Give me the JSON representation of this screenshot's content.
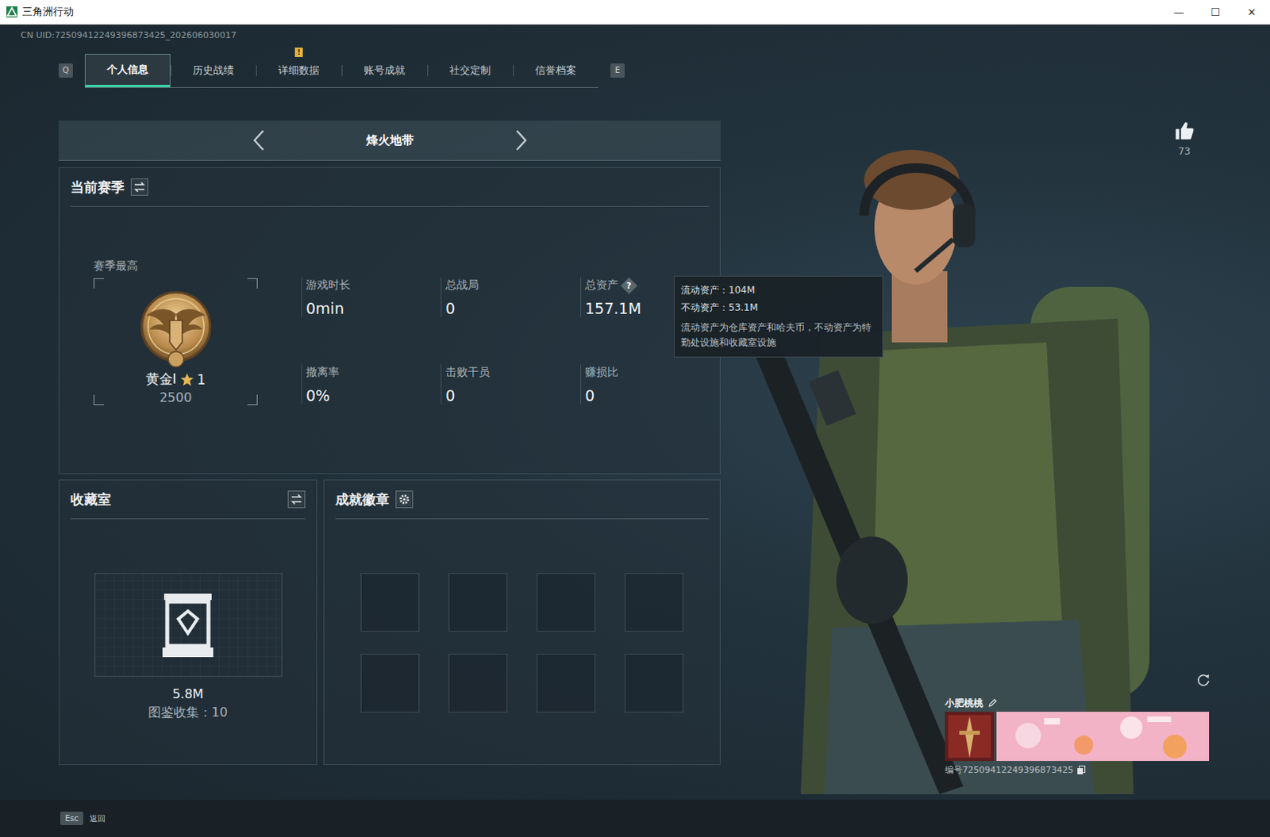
{
  "window": {
    "title": "三角洲行动",
    "controls": [
      "—",
      "☐",
      "✕"
    ]
  },
  "uid": "CN UID:72509412249396873425_202606030017",
  "tabs": {
    "prev_key": "Q",
    "next_key": "E",
    "alert_mark": "!",
    "items": [
      {
        "label": "个人信息",
        "selected": true,
        "alert": false
      },
      {
        "label": "历史战绩",
        "selected": false,
        "alert": false
      },
      {
        "label": "详细数据",
        "selected": false,
        "alert": true
      },
      {
        "label": "账号成就",
        "selected": false,
        "alert": false
      },
      {
        "label": "社交定制",
        "selected": false,
        "alert": false
      },
      {
        "label": "信誉档案",
        "selected": false,
        "alert": false
      }
    ]
  },
  "mode": {
    "label": "烽火地带"
  },
  "season": {
    "title": "当前赛季",
    "best_label": "赛季最高",
    "rank": "黄金I",
    "stars": "1",
    "score": "2500",
    "stats": [
      {
        "label": "游戏时长",
        "value": "0min",
        "help": ""
      },
      {
        "label": "总战局",
        "value": "0",
        "help": ""
      },
      {
        "label": "总资产",
        "value": "157.1M",
        "help": "?"
      },
      {
        "label": "撤离率",
        "value": "0%",
        "help": ""
      },
      {
        "label": "击败干员",
        "value": "0",
        "help": ""
      },
      {
        "label": "赚损比",
        "value": "0",
        "help": ""
      }
    ]
  },
  "tooltip": {
    "lines": [
      "流动资产：104M",
      "不动资产：53.1M"
    ],
    "note": "流动资产为仓库资产和哈夫币，不动资产为特勤处设施和收藏室设施"
  },
  "collection": {
    "title": "收藏室",
    "value": "5.8M",
    "count": "图鉴收集：10"
  },
  "achievements": {
    "title": "成就徽章",
    "slots": [
      {
        "filled": false
      },
      {
        "filled": false
      },
      {
        "filled": false
      },
      {
        "filled": false
      },
      {
        "filled": false
      },
      {
        "filled": false
      },
      {
        "filled": false
      },
      {
        "filled": false
      }
    ]
  },
  "likes": "73",
  "player": {
    "name": "小肥桃桃",
    "id": "编号72509412249396873425"
  },
  "footer": {
    "key": "Esc",
    "label": "返回"
  }
}
